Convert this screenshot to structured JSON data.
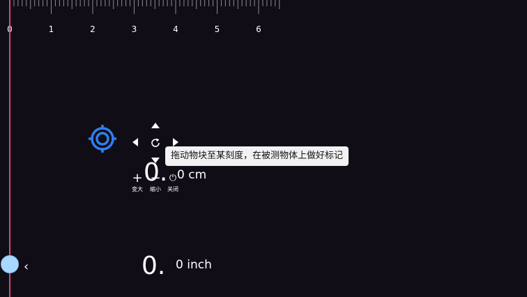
{
  "ruler": {
    "unit": "cm",
    "labels": [
      "0",
      "1",
      "2",
      "3",
      "4",
      "5",
      "6"
    ]
  },
  "cm_reading": {
    "value": "0.",
    "text": "0 cm"
  },
  "inch_reading": {
    "value": "0.",
    "text": "0 inch"
  },
  "tooltip": {
    "text": "拖动物块至某刻度，在被测物体上做好标记"
  },
  "controls": {
    "enlarge": {
      "symbol": "+",
      "label": "变大"
    },
    "shrink": {
      "symbol": "−",
      "label": "缩小"
    },
    "close": {
      "symbol": "⏻",
      "label": "关闭"
    }
  },
  "collapse": {
    "symbol": "‹"
  },
  "colors": {
    "background": "#100d17",
    "marker_line": "#e0457a",
    "target": "#2f7ff0",
    "handle": "#a9d8ff"
  },
  "icons": [
    "target-icon",
    "arrow-up-icon",
    "arrow-down-icon",
    "arrow-left-icon",
    "arrow-right-icon",
    "refresh-icon",
    "power-icon"
  ]
}
